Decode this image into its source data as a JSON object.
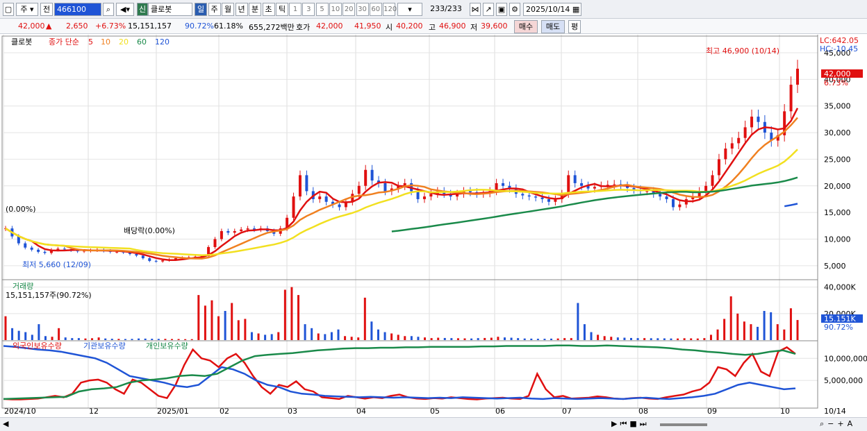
{
  "toolbar": {
    "market": "주",
    "prev_label": "전",
    "code": "466100",
    "stock_name": "클로봇",
    "badge": "신",
    "periods": [
      "일",
      "주",
      "월",
      "년",
      "분",
      "초",
      "틱"
    ],
    "active_period": "일",
    "nums": [
      "1",
      "3",
      "5",
      "10",
      "20",
      "30",
      "60",
      "120"
    ],
    "count": "233",
    "count_total": "/233",
    "date": "2025/10/14"
  },
  "quote": {
    "price": "42,000",
    "arrow": "▲",
    "change": "2,650",
    "change_pct": "+6.73%",
    "volume": "15,151,157",
    "vol_ratio": "90.72%",
    "turnover": "61.18%",
    "amount": "655,272백만",
    "ask_label": "호가",
    "ask": "42,000",
    "bid": "41,950",
    "open_label": "시",
    "open": "40,200",
    "high_label": "고",
    "high": "46,900",
    "low_label": "저",
    "low": "39,600",
    "buy": "매수",
    "sell": "매도",
    "eval": "평"
  },
  "panels": {
    "price_legend": {
      "name": "클로봇",
      "type": "종가 단순",
      "periods": [
        "5",
        "10",
        "20",
        "60",
        "120"
      ]
    },
    "volume_title": "거래량",
    "volume_value": "15,151,157주(90.72%)",
    "holdings_titles": [
      "외국인보유수량",
      "기관보유수량",
      "개인보유수량"
    ]
  },
  "annotations": {
    "high": "최고 46,900 (10/14)",
    "low": "최저 5,660 (12/09)",
    "start": "(0.00%)",
    "dividend": "배당락(0.00%)",
    "lc": "LC:642.05",
    "hc": "HC:-10.45",
    "current_price": "42,000",
    "current_pct": "6.73%",
    "current_volume": "15.151K",
    "current_vol_pct": "90.72%"
  },
  "chart_data": {
    "type": "line",
    "title": "클로봇",
    "x_labels": [
      "2024/10",
      "12",
      "2025/01",
      "02",
      "03",
      "04",
      "05",
      "06",
      "07",
      "08",
      "09",
      "10"
    ],
    "last_x_label": "10/14",
    "price_axis": {
      "ticks": [
        5000,
        10000,
        15000,
        20000,
        25000,
        30000,
        35000,
        40000,
        45000
      ],
      "ylim": [
        2500,
        48000
      ],
      "tick_labels": [
        "5,000",
        "10,000",
        "15,000",
        "20,000",
        "25,000",
        "30,000",
        "35,000",
        "40,000",
        "45,000"
      ]
    },
    "price_close": [
      12000,
      10500,
      9200,
      8400,
      8000,
      7600,
      7400,
      8000,
      8200,
      8100,
      7900,
      7700,
      7800,
      7900,
      8000,
      7800,
      7600,
      7600,
      7500,
      7200,
      6900,
      6400,
      5900,
      5800,
      6000,
      6200,
      6400,
      6500,
      6600,
      6700,
      6800,
      8500,
      10000,
      11500,
      11200,
      11500,
      11800,
      12000,
      11800,
      12000,
      11500,
      11000,
      12000,
      14000,
      18000,
      22000,
      19000,
      17500,
      18000,
      17000,
      16500,
      16000,
      17000,
      18500,
      20000,
      23000,
      21000,
      20500,
      19000,
      19500,
      20000,
      20500,
      19000,
      17500,
      18000,
      18500,
      19000,
      18500,
      18000,
      18500,
      19000,
      18800,
      18500,
      18600,
      19000,
      20500,
      20000,
      19500,
      18500,
      18200,
      18000,
      17800,
      17500,
      17000,
      17500,
      18500,
      22000,
      20500,
      20000,
      19500,
      19800,
      20000,
      20200,
      20300,
      20000,
      19600,
      19300,
      19000,
      19000,
      18500,
      18000,
      17500,
      16000,
      16500,
      17500,
      18000,
      19000,
      20000,
      22000,
      25000,
      27000,
      28000,
      29000,
      31000,
      33000,
      32000,
      30000,
      28500,
      29500,
      34000,
      39000,
      42000
    ],
    "volume_axis": {
      "ticks": [
        20000,
        40000
      ],
      "tick_labels": [
        "20,000K",
        "40,000K"
      ],
      "ylim": [
        0,
        44000
      ]
    },
    "volume_k": [
      18000,
      9000,
      7000,
      6000,
      4000,
      12000,
      3000,
      2500,
      9000,
      2000,
      1500,
      1500,
      1200,
      1400,
      2000,
      1200,
      1000,
      900,
      800,
      900,
      1200,
      1100,
      1000,
      900,
      900,
      800,
      800,
      700,
      700,
      34000,
      26000,
      30000,
      18000,
      22000,
      28000,
      15000,
      16000,
      6000,
      5000,
      4000,
      4500,
      6000,
      38000,
      40000,
      34000,
      12000,
      9000,
      5000,
      4500,
      6000,
      8000,
      3000,
      2500,
      2000,
      32000,
      14000,
      8000,
      6000,
      5000,
      4000,
      3000,
      3000,
      2500,
      2000,
      1500,
      1800,
      1600,
      1500,
      1400,
      1300,
      1200,
      1500,
      1600,
      1800,
      2500,
      2000,
      1800,
      1500,
      1200,
      1100,
      1000,
      1000,
      1100,
      1200,
      1500,
      1500,
      28000,
      12000,
      6000,
      4000,
      3000,
      2500,
      2000,
      1800,
      1600,
      1500,
      1500,
      1400,
      1400,
      1300,
      1200,
      1200,
      1400,
      1300,
      1200,
      1500,
      4000,
      8000,
      16000,
      33000,
      20000,
      14000,
      12000,
      10000,
      22000,
      21000,
      12000,
      8000,
      24000,
      15151
    ],
    "holdings_axis": {
      "ticks": [
        5000000,
        10000000
      ],
      "tick_labels": [
        "5,000,000",
        "10,000,000"
      ],
      "ylim": [
        0,
        13500000
      ]
    },
    "series": [
      {
        "name": "외국인보유수량",
        "color": "#e01010",
        "values": [
          800000,
          700000,
          700000,
          800000,
          900000,
          1200000,
          1500000,
          1200000,
          2000000,
          4500000,
          5000000,
          5200000,
          4500000,
          3000000,
          2000000,
          5200000,
          4500000,
          3000000,
          1500000,
          1000000,
          4000000,
          8500000,
          12000000,
          10000000,
          9500000,
          8000000,
          10000000,
          11000000,
          9000000,
          6000000,
          3500000,
          2000000,
          4000000,
          3500000,
          4800000,
          3000000,
          2500000,
          1200000,
          1000000,
          800000,
          1500000,
          1200000,
          900000,
          1200000,
          1000000,
          1500000,
          1800000,
          1200000,
          900000,
          800000,
          1000000,
          900000,
          1200000,
          1000000,
          800000,
          700000,
          900000,
          1000000,
          1100000,
          900000,
          800000,
          1500000,
          6500000,
          3000000,
          1200000,
          1500000,
          900000,
          1000000,
          1100000,
          1400000,
          1200000,
          900000,
          800000,
          1000000,
          1100000,
          900000,
          800000,
          1200000,
          1500000,
          1800000,
          2500000,
          3000000,
          4500000,
          8000000,
          7500000,
          6000000,
          9000000,
          11000000,
          7000000,
          6000000,
          11500000,
          12500000,
          11000000
        ]
      },
      {
        "name": "기관보유수량",
        "color": "#1f54d6",
        "values": [
          12800000,
          12600000,
          12300000,
          12000000,
          11800000,
          11500000,
          11000000,
          10500000,
          10000000,
          9000000,
          7500000,
          6000000,
          5500000,
          5000000,
          4500000,
          3800000,
          3500000,
          4000000,
          6000000,
          8000000,
          7500000,
          6500000,
          5000000,
          4000000,
          3500000,
          2500000,
          2000000,
          1800000,
          1500000,
          1400000,
          1300000,
          1200000,
          1300000,
          1200000,
          1100000,
          1200000,
          1100000,
          1000000,
          1100000,
          1000000,
          1200000,
          1100000,
          1000000,
          900000,
          1000000,
          1100000,
          900000,
          800000,
          1000000,
          900000,
          800000,
          900000,
          1000000,
          900000,
          800000,
          1000000,
          1100000,
          900000,
          800000,
          1000000,
          1200000,
          1500000,
          2000000,
          3000000,
          4000000,
          4500000,
          4000000,
          3500000,
          3000000,
          3200000
        ]
      },
      {
        "name": "개인보유수량",
        "color": "#1a8a4a",
        "values": [
          800000,
          900000,
          1000000,
          1100000,
          1200000,
          1300000,
          2500000,
          3000000,
          3200000,
          3500000,
          4500000,
          5000000,
          5200000,
          5500000,
          6000000,
          6200000,
          6000000,
          6500000,
          8000000,
          9500000,
          10500000,
          10800000,
          11000000,
          11200000,
          11500000,
          11800000,
          12000000,
          12200000,
          12300000,
          12300000,
          12400000,
          12400000,
          12500000,
          12500000,
          12600000,
          12600000,
          12600000,
          12600000,
          12700000,
          12700000,
          12800000,
          12800000,
          12800000,
          12800000,
          12900000,
          12900000,
          12800000,
          12800000,
          12900000,
          12800000,
          12700000,
          12600000,
          12500000,
          12300000,
          12000000,
          11800000,
          11500000,
          11300000,
          11000000,
          10800000,
          11000000,
          11500000,
          11800000,
          11000000
        ]
      }
    ]
  }
}
